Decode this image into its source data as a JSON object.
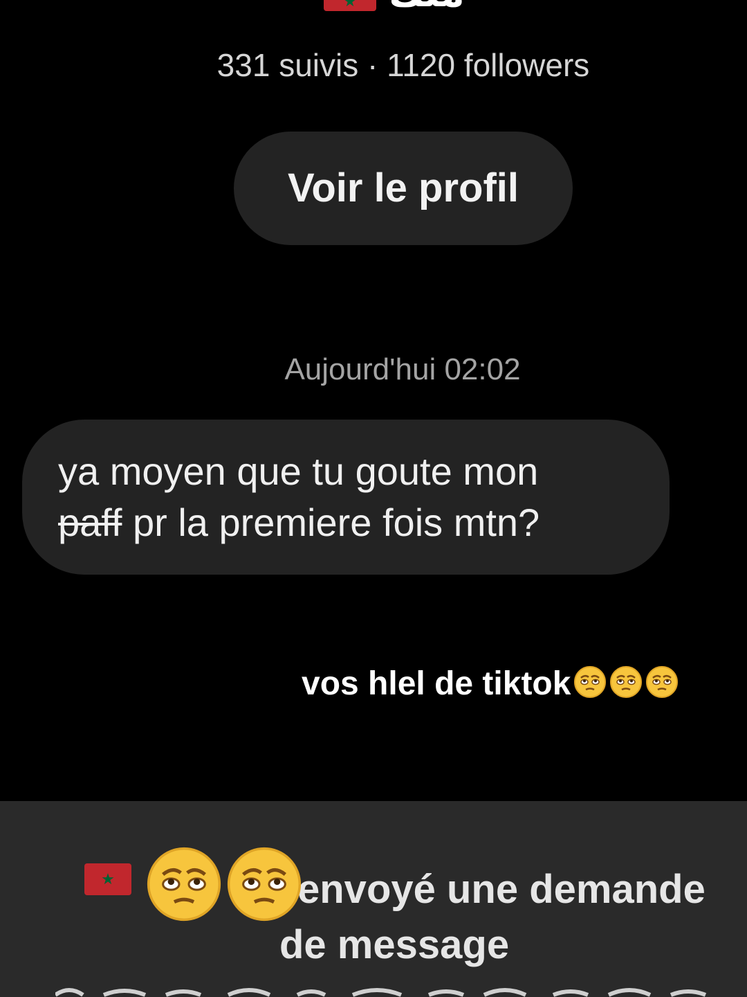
{
  "header": {
    "flag_icon": "morocco-flag-icon",
    "name": "ملك",
    "stats_text": "331 suivis · 1120 followers",
    "profile_button_label": "Voir le profil"
  },
  "conversation": {
    "timestamp": "Aujourd'hui 02:02",
    "message": {
      "line1": "ya moyen que tu goute mon",
      "struck_word": "paff",
      "line2_rest": " pr la premiere fois mtn?"
    }
  },
  "overlay": {
    "caption": "vos hlel de tiktok",
    "emoji_icon": "pensive-face-emoji"
  },
  "request_panel": {
    "flag_icon": "morocco-flag-icon",
    "line1": "envoyé une demande",
    "line2": "de message",
    "emoji_icon": "pensive-face-emoji"
  },
  "colors": {
    "background": "#000000",
    "bubble": "#232323",
    "panel": "#2a2a2a",
    "flag_red": "#c1272d",
    "flag_green": "#006233"
  }
}
